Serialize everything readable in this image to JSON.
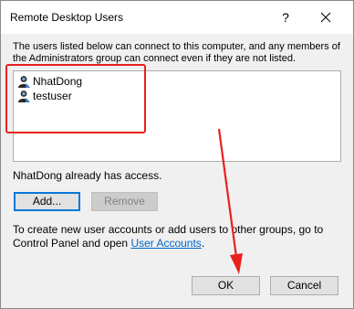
{
  "window": {
    "title": "Remote Desktop Users",
    "help_glyph": "?",
    "close_icon": "close-icon"
  },
  "description": "The users listed below can connect to this computer, and any members of the Administrators group can connect even if they are not listed.",
  "users": [
    {
      "name": "NhatDong",
      "icon": "user-icon"
    },
    {
      "name": "testuser",
      "icon": "user-icon"
    }
  ],
  "access_status": "NhatDong already has access.",
  "buttons": {
    "add": "Add...",
    "remove": "Remove",
    "ok": "OK",
    "cancel": "Cancel"
  },
  "info": {
    "text": "To create new user accounts or add users to other groups, go to Control Panel and open ",
    "link": "User Accounts",
    "suffix": "."
  },
  "annotation_color": "#e8211c"
}
